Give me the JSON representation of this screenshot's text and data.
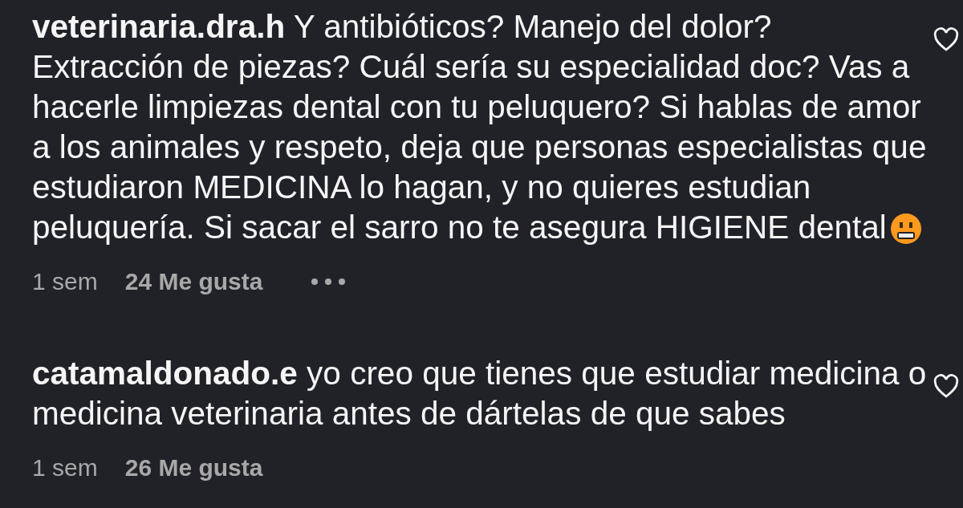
{
  "comments": [
    {
      "username": "veterinaria.dra.h",
      "text": "Y antibióticos? Manejo del dolor? Extracción de piezas? Cuál sería su especialidad doc? Vas a hacerle limpiezas dental con tu peluquero? Si hablas de amor a los animales y respeto, deja que personas especialistas que estudiaron MEDICINA lo hagan, y no quieres estudian peluquería. Si sacar el sarro no te asegura HIGIENE dental",
      "emoji": true,
      "time": "1 sem",
      "likes": "24 Me gusta",
      "more": true,
      "liked": false
    },
    {
      "username": "catamaldonado.e",
      "text": "yo creo que tienes que estudiar medicina o medicina veterinaria antes de dártelas de que sabes",
      "emoji": false,
      "time": "1 sem",
      "likes": "26 Me gusta",
      "more": false,
      "liked": false
    }
  ]
}
